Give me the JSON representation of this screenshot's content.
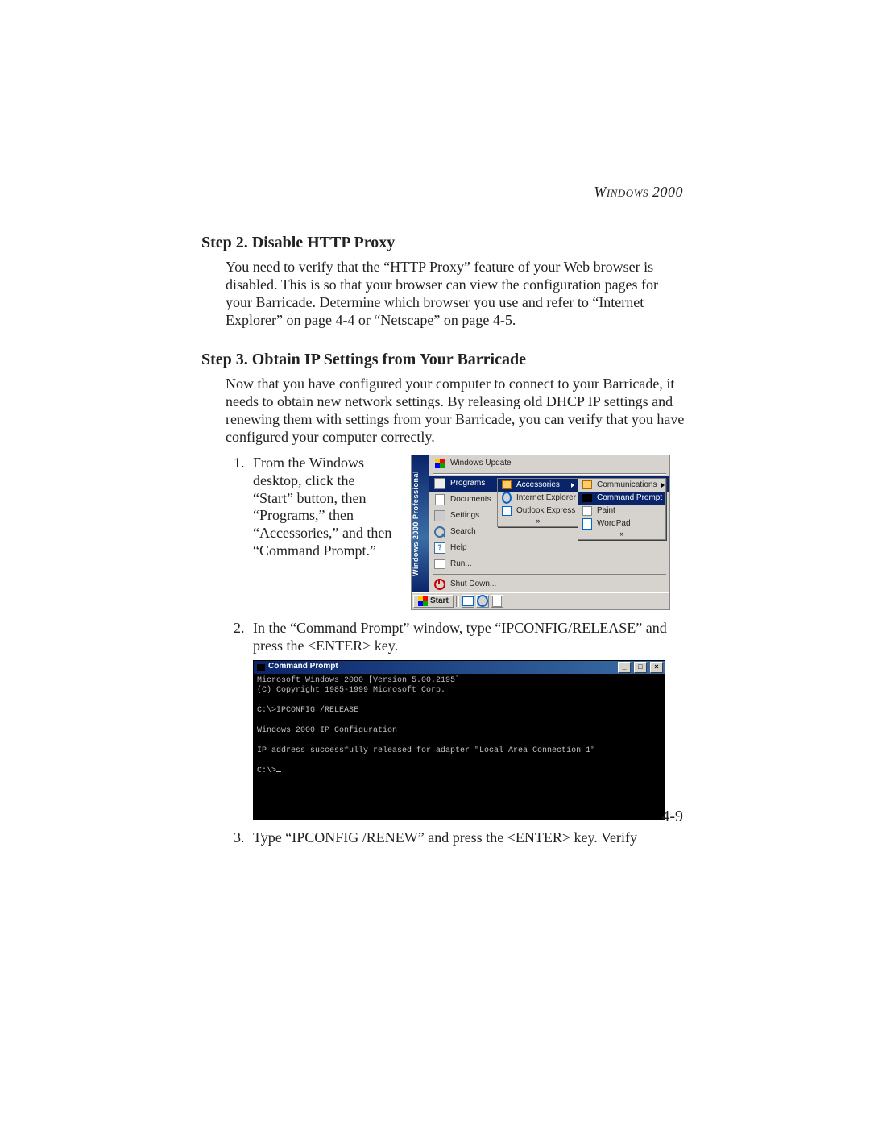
{
  "header": {
    "running_head": "Windows 2000"
  },
  "page_number": "4-9",
  "step2": {
    "heading": "Step 2. Disable HTTP Proxy",
    "body": "You need to verify that the “HTTP Proxy” feature of your Web browser is disabled. This is so that your browser can view the configuration pages for your Barricade. Determine which browser you use and refer to “Internet Explorer” on page 4-4 or “Netscape” on page 4-5."
  },
  "step3": {
    "heading": "Step 3. Obtain IP Settings from Your Barricade",
    "intro": "Now that you have configured your computer to connect to your Barricade, it needs to obtain new network settings. By releasing old DHCP IP settings and renewing them with settings from your Barricade, you can verify that you have configured your computer correctly.",
    "items": {
      "1": "From the Windows desktop, click the “Start” button, then “Programs,” then “Accessories,” and then “Command Prompt.”",
      "2": "In the “Command Prompt” window, type “IPCONFIG/RELEASE” and press the <ENTER> key.",
      "3": "Type “IPCONFIG /RENEW” and press the <ENTER> key. Verify"
    }
  },
  "startmenu": {
    "banner": "Windows 2000 Professional",
    "items": {
      "windows_update": "Windows Update",
      "programs": "Programs",
      "documents": "Documents",
      "settings": "Settings",
      "search": "Search",
      "help": "Help",
      "run": "Run...",
      "shutdown": "Shut Down..."
    },
    "programs_sub": {
      "accessories": "Accessories",
      "ie": "Internet Explorer",
      "oe": "Outlook Express"
    },
    "accessories_sub": {
      "communications": "Communications",
      "command_prompt": "Command Prompt",
      "paint": "Paint",
      "wordpad": "WordPad"
    },
    "taskbar": {
      "start": "Start"
    },
    "chev": "»"
  },
  "cmd": {
    "title": "Command Prompt",
    "lines": {
      "l1": "Microsoft Windows 2000 [Version 5.00.2195]",
      "l2": "(C) Copyright 1985-1999 Microsoft Corp.",
      "l3": "",
      "l4": "C:\\>IPCONFIG /RELEASE",
      "l5": "",
      "l6": "Windows 2000 IP Configuration",
      "l7": "",
      "l8": "IP address successfully released for adapter \"Local Area Connection 1\"",
      "l9": "",
      "l10": "C:\\>"
    },
    "buttons": {
      "min": "_",
      "max": "□",
      "close": "×"
    }
  }
}
